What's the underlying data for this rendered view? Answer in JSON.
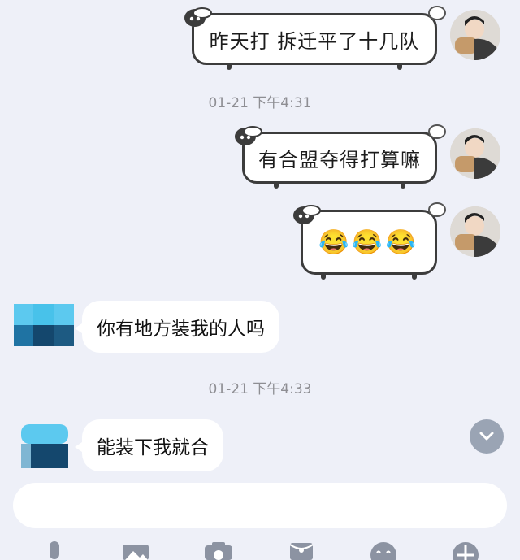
{
  "messages": [
    {
      "side": "out",
      "text": "昨天打 拆迁平了十几队"
    },
    {
      "side": "out",
      "text": "有合盟夺得打算嘛"
    },
    {
      "side": "out",
      "text": "😂😂😂"
    },
    {
      "side": "in",
      "text": "你有地方装我的人吗"
    },
    {
      "side": "in",
      "text": "能装下我就合"
    }
  ],
  "timestamps": [
    "01-21 下午4:31",
    "01-21 下午4:33"
  ],
  "input": {
    "placeholder": ""
  },
  "toolbar": {
    "icons": [
      "microphone-icon",
      "image-icon",
      "camera-icon",
      "red-packet-icon",
      "emoji-icon",
      "plus-icon"
    ]
  },
  "colors": {
    "background": "#eef0f8",
    "bubble": "#ffffff",
    "sheep_outline": "#3c3c3c",
    "timestamp": "#8e8e93",
    "scroll_button": "#9aa4b4"
  }
}
